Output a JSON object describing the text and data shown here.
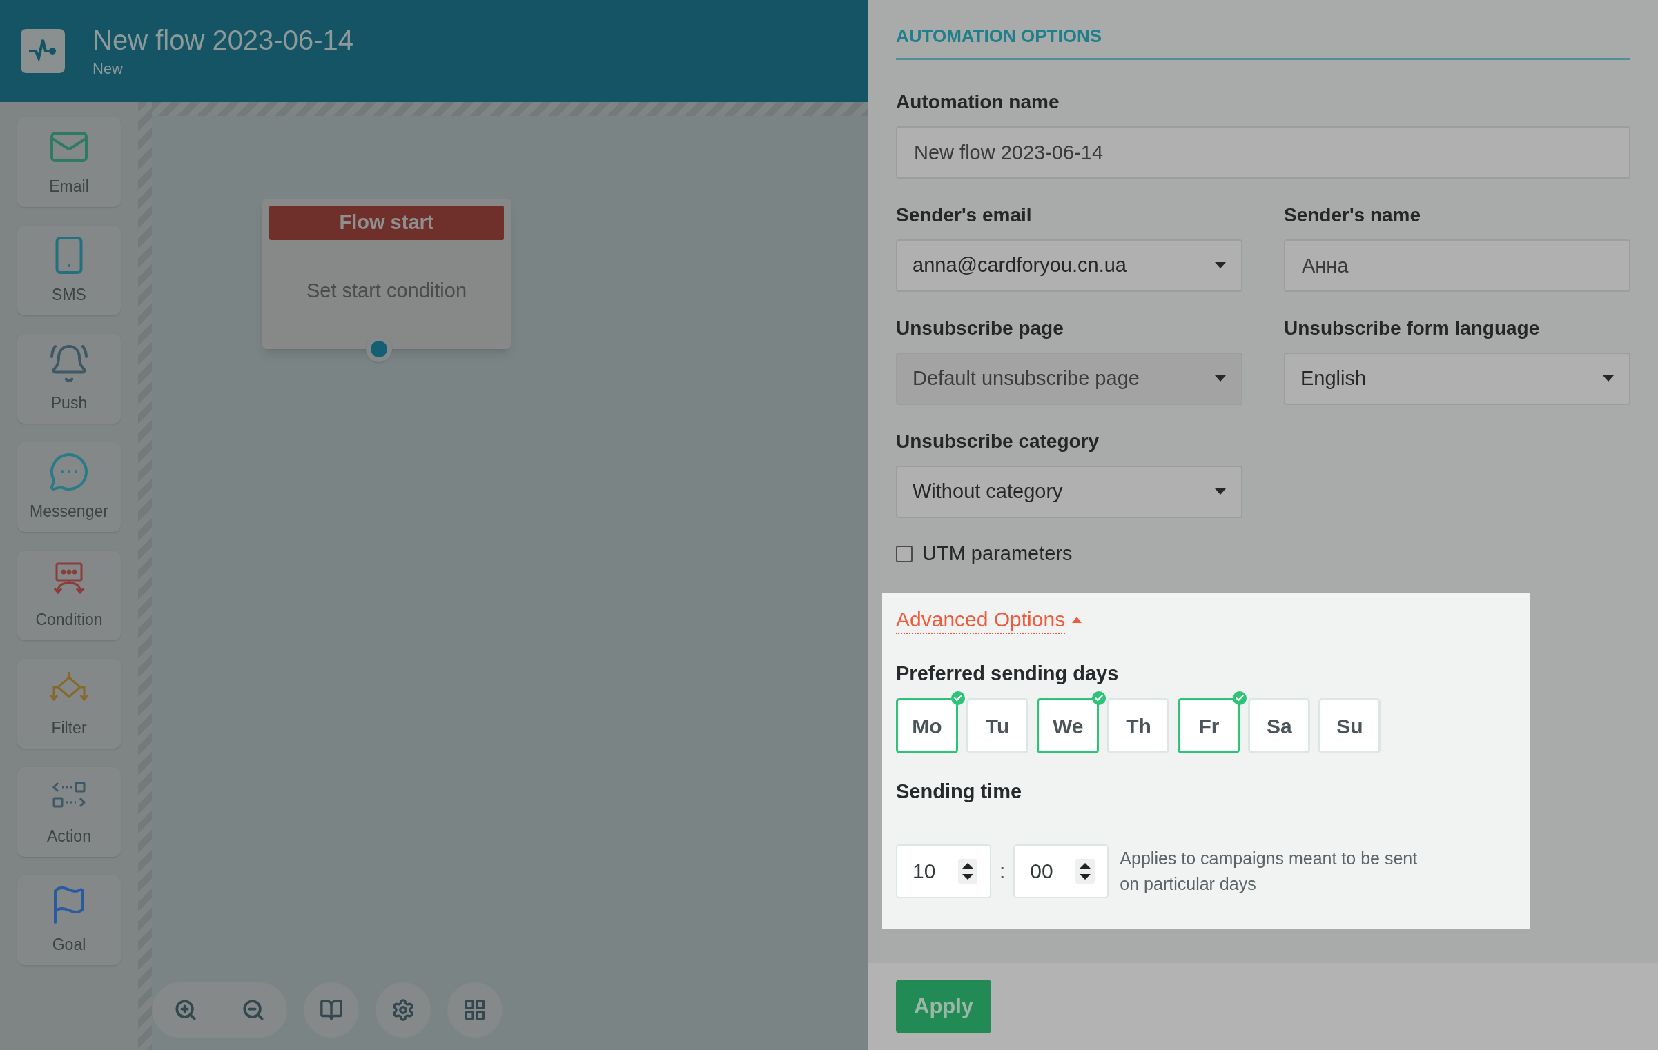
{
  "header": {
    "title": "New flow 2023-06-14",
    "subtitle": "New"
  },
  "sidebar": {
    "items": [
      {
        "label": "Email",
        "kind": "email"
      },
      {
        "label": "SMS",
        "kind": "sms"
      },
      {
        "label": "Push",
        "kind": "push"
      },
      {
        "label": "Messenger",
        "kind": "messenger"
      },
      {
        "label": "Condition",
        "kind": "condition"
      },
      {
        "label": "Filter",
        "kind": "filter"
      },
      {
        "label": "Action",
        "kind": "action"
      },
      {
        "label": "Goal",
        "kind": "goal"
      }
    ]
  },
  "canvas": {
    "node": {
      "title": "Flow start",
      "text": "Set start condition"
    }
  },
  "panel": {
    "title": "AUTOMATION OPTIONS",
    "rows": [
      [
        {
          "label": "Automation name",
          "value": "New flow 2023-06-14",
          "kind": "input",
          "disabled": false
        }
      ],
      [
        {
          "label": "Sender's email",
          "value": "anna@cardforyou.cn.ua",
          "kind": "select",
          "disabled": false
        },
        {
          "label": "Sender's name",
          "value": "Анна",
          "kind": "input",
          "disabled": false
        }
      ],
      [
        {
          "label": "Unsubscribe page",
          "value": "Default unsubscribe page",
          "kind": "select",
          "disabled": true
        },
        {
          "label": "Unsubscribe form language",
          "value": "English",
          "kind": "select",
          "disabled": false
        }
      ],
      [
        {
          "label": "Unsubscribe category",
          "value": "Without category",
          "kind": "select",
          "disabled": false
        }
      ]
    ],
    "utm": {
      "label": "UTM parameters",
      "checked": false
    },
    "advanced": {
      "toggle": "Advanced Options",
      "expanded": true,
      "days_label": "Preferred sending days",
      "days": [
        {
          "label": "Mo",
          "selected": true
        },
        {
          "label": "Tu",
          "selected": false
        },
        {
          "label": "We",
          "selected": true
        },
        {
          "label": "Th",
          "selected": false
        },
        {
          "label": "Fr",
          "selected": true
        },
        {
          "label": "Sa",
          "selected": false
        },
        {
          "label": "Su",
          "selected": false
        }
      ],
      "time_label": "Sending time",
      "hour": "10",
      "separator": ":",
      "minute": "00",
      "note": "Applies to campaigns meant to be sent on particular days"
    },
    "apply": "Apply"
  }
}
